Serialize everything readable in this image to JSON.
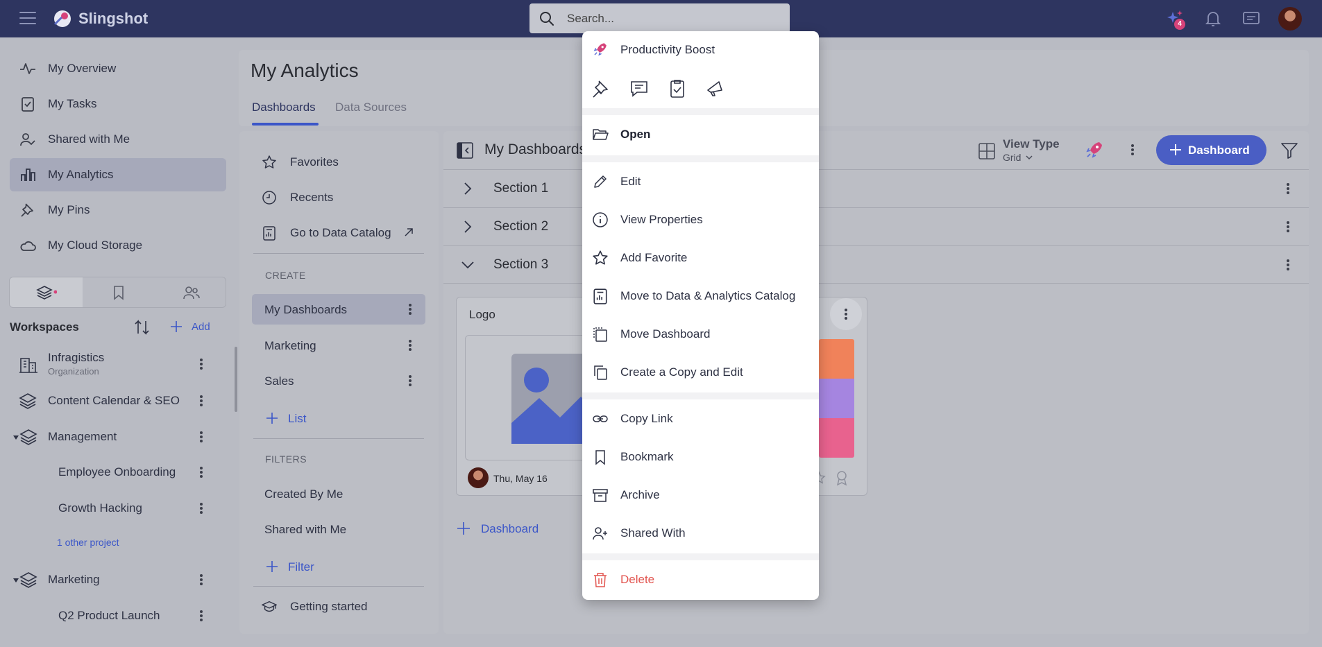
{
  "app": {
    "title": "Slingshot"
  },
  "search": {
    "placeholder": "Search..."
  },
  "topbar": {
    "notifications_badge": "4"
  },
  "sidebar": {
    "items": [
      {
        "label": "My Overview",
        "icon": "pulse-icon"
      },
      {
        "label": "My Tasks",
        "icon": "clipboard-check-icon"
      },
      {
        "label": "Shared with Me",
        "icon": "user-check-icon"
      },
      {
        "label": "My Analytics",
        "icon": "bar-chart-icon",
        "active": true
      },
      {
        "label": "My Pins",
        "icon": "pin-icon"
      },
      {
        "label": "My Cloud Storage",
        "icon": "cloud-icon"
      }
    ],
    "workspaces_title": "Workspaces",
    "add_label": "Add",
    "workspaces": [
      {
        "label": "Infragistics",
        "sub": "Organization"
      },
      {
        "label": "Content Calendar & SEO"
      },
      {
        "label": "Management"
      },
      {
        "label": "Employee Onboarding"
      },
      {
        "label": "Growth Hacking"
      },
      {
        "label": "Marketing"
      },
      {
        "label": "Q2 Product Launch"
      }
    ],
    "other_projects": "1 other project"
  },
  "main": {
    "title": "My Analytics",
    "tabs": [
      "Dashboards",
      "Data Sources"
    ]
  },
  "left_panel": {
    "favorites": "Favorites",
    "recents": "Recents",
    "catalog": "Go to Data Catalog",
    "create_caption": "CREATE",
    "lists": [
      "My Dashboards",
      "Marketing",
      "Sales"
    ],
    "add_list": "List",
    "filters_caption": "FILTERS",
    "filters": [
      "Created By Me",
      "Shared with Me"
    ],
    "add_filter": "Filter",
    "getting_started": "Getting started"
  },
  "dashboards": {
    "title": "My Dashboards",
    "view_type_label": "View Type",
    "view_type_value": "Grid",
    "new_button": "Dashboard",
    "sections": [
      "Section 1",
      "Section 2",
      "Section 3"
    ],
    "card": {
      "title": "Logo",
      "date": "Thu, May 16"
    },
    "add_dashboard": "Dashboard"
  },
  "context_menu": {
    "header": "Productivity Boost",
    "items": [
      {
        "label": "Open",
        "icon": "folder-open-icon"
      },
      {
        "label": "Edit",
        "icon": "pencil-icon"
      },
      {
        "label": "View Properties",
        "icon": "info-icon"
      },
      {
        "label": "Add Favorite",
        "icon": "star-icon"
      },
      {
        "label": "Move to Data & Analytics Catalog",
        "icon": "catalog-icon"
      },
      {
        "label": "Move Dashboard",
        "icon": "move-icon"
      },
      {
        "label": "Create a Copy and Edit",
        "icon": "copy-icon"
      },
      {
        "label": "Copy Link",
        "icon": "link-icon"
      },
      {
        "label": "Bookmark",
        "icon": "bookmark-icon"
      },
      {
        "label": "Archive",
        "icon": "archive-icon"
      },
      {
        "label": "Shared With",
        "icon": "user-plus-icon"
      },
      {
        "label": "Delete",
        "icon": "trash-icon"
      }
    ]
  },
  "colors": {
    "topbar": "#2e3560",
    "accent": "#3b56c8",
    "delete": "#e2544f",
    "tile_orange": "#f0825a",
    "tile_purple": "#a585e0",
    "tile_pink": "#e8628e"
  }
}
